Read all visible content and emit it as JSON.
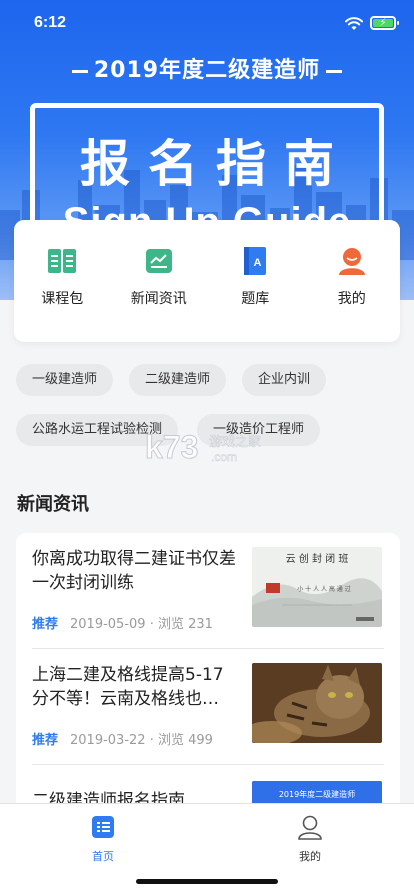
{
  "status_bar": {
    "time": "6:12"
  },
  "banner": {
    "title": "2019年度二级建造师",
    "guide_cn": "报名指南",
    "guide_en": "Sign Up Guide"
  },
  "quick_nav": [
    {
      "label": "课程包",
      "icon": "book-icon",
      "color": "#3fb58a"
    },
    {
      "label": "新闻资讯",
      "icon": "news-icon",
      "color": "#3fb58a"
    },
    {
      "label": "题库",
      "icon": "question-bank-icon",
      "color": "#2f7bf0"
    },
    {
      "label": "我的",
      "icon": "user-icon",
      "color": "#f0693a"
    }
  ],
  "tags": [
    "一级建造师",
    "二级建造师",
    "企业内训",
    "公路水运工程试验检测",
    "一级造价工程师"
  ],
  "news_section": {
    "title": "新闻资讯"
  },
  "news": [
    {
      "title": "你离成功取得二建证书仅差一次封闭训练",
      "tag": "推荐",
      "date": "2019-05-09",
      "views": "浏览 231",
      "thumb": {
        "heading": "云 创 封 闭 班",
        "caption": "小 十 人 人 高 通 过"
      }
    },
    {
      "title": "上海二建及格线提高5-17分不等！云南及格线也…",
      "tag": "推荐",
      "date": "2019-03-22",
      "views": "浏览 499"
    },
    {
      "title": "二级建造师报名指南",
      "thumb": {
        "banner": "2019年度二级建造师"
      }
    }
  ],
  "watermark": {
    "brand": "k73",
    "sub": "游戏之家",
    "domain": ".com"
  },
  "tabbar": [
    {
      "label": "首页",
      "icon": "home-icon",
      "active": true
    },
    {
      "label": "我的",
      "icon": "profile-icon",
      "active": false
    }
  ],
  "colors": {
    "primary": "#2f7bf0",
    "green": "#3fb58a",
    "orange": "#f0693a"
  }
}
